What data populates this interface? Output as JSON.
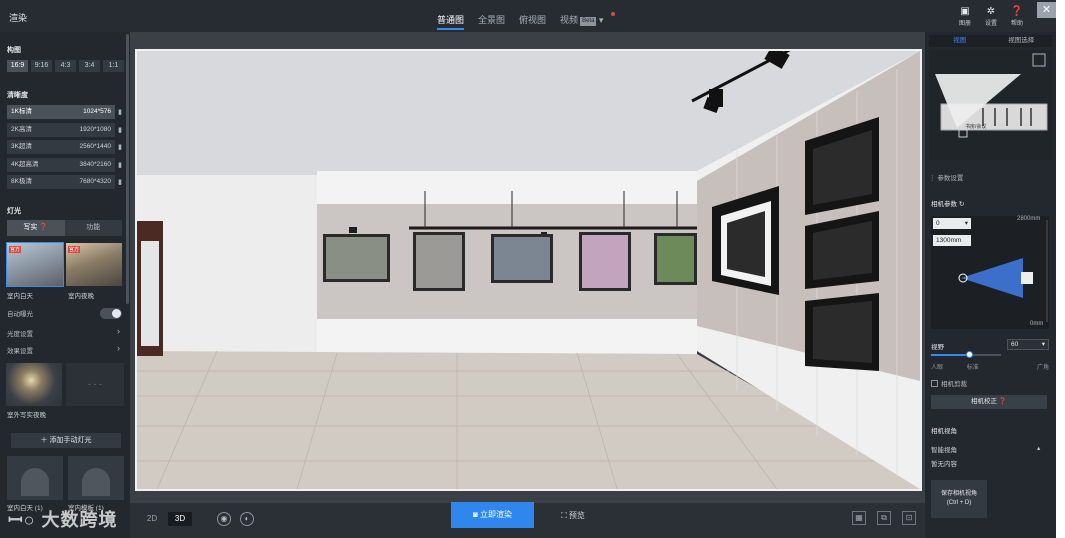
{
  "app": {
    "title": "渲染"
  },
  "view_tabs": [
    {
      "label": "普通图",
      "active": true
    },
    {
      "label": "全景图"
    },
    {
      "label": "俯视图"
    },
    {
      "label": "视频",
      "badge": "Beta"
    }
  ],
  "top_tools": [
    {
      "icon": "image-icon",
      "label": "图册"
    },
    {
      "icon": "gear-icon",
      "label": "设置"
    },
    {
      "icon": "help-icon",
      "label": "帮助"
    }
  ],
  "left": {
    "composition_title": "构图",
    "ratios": [
      "16:9",
      "9:16",
      "4:3",
      "3:4",
      "1:1"
    ],
    "active_ratio": "16:9",
    "resolution_title": "清晰度",
    "resolutions": [
      {
        "name": "1K标清",
        "size": "1024*576",
        "active": true
      },
      {
        "name": "2K高清",
        "size": "1920*1080"
      },
      {
        "name": "3K超清",
        "size": "2560*1440"
      },
      {
        "name": "4K超高清",
        "size": "3840*2160"
      },
      {
        "name": "8K极清",
        "size": "7680*4320"
      }
    ],
    "lighting_title": "灯光",
    "lighting_tabs": [
      "写实",
      "功能"
    ],
    "presets": [
      {
        "label": "室内白天",
        "tag": "官方"
      },
      {
        "label": "室内夜晚",
        "tag": "官方"
      }
    ],
    "auto_exposure": "自动曝光",
    "light_settings": "光度设置",
    "effect_settings": "效果设置",
    "env_label": "室外写实夜晚",
    "env_empty": "- - -",
    "add_light": "添加手动灯光",
    "light_cards": [
      "室内白天 (1)",
      "室内模板 (1)"
    ]
  },
  "viewport": {
    "dim_2d": "2D",
    "dim_3d": "3D",
    "render_button": "立即渲染",
    "preview_button": "预览"
  },
  "watermark": "大数跨境",
  "right": {
    "tabs": [
      "视图",
      "视图选择"
    ],
    "minimap_text": "书房/会议",
    "param_section": "参数设置",
    "camera_params": "相机参数",
    "height_value": "0",
    "distance_value": "1300mm",
    "top_mark": "2800mm",
    "bottom_mark": "0mm",
    "fov_label": "视野",
    "fov_value": "60",
    "fov_marks": [
      "人眼",
      "标准",
      "广角"
    ],
    "fov_level": 0.55,
    "clip_label": "相机剪裁",
    "correct_button": "相机校正",
    "view_section": "相机视角",
    "smart_view": "智能视角",
    "no_content": "暂无内容",
    "save_view": "保存相机视角",
    "save_shortcut": "(Ctrl + D)"
  },
  "colors": {
    "accent": "#2f86ec",
    "panel": "#23282e"
  }
}
